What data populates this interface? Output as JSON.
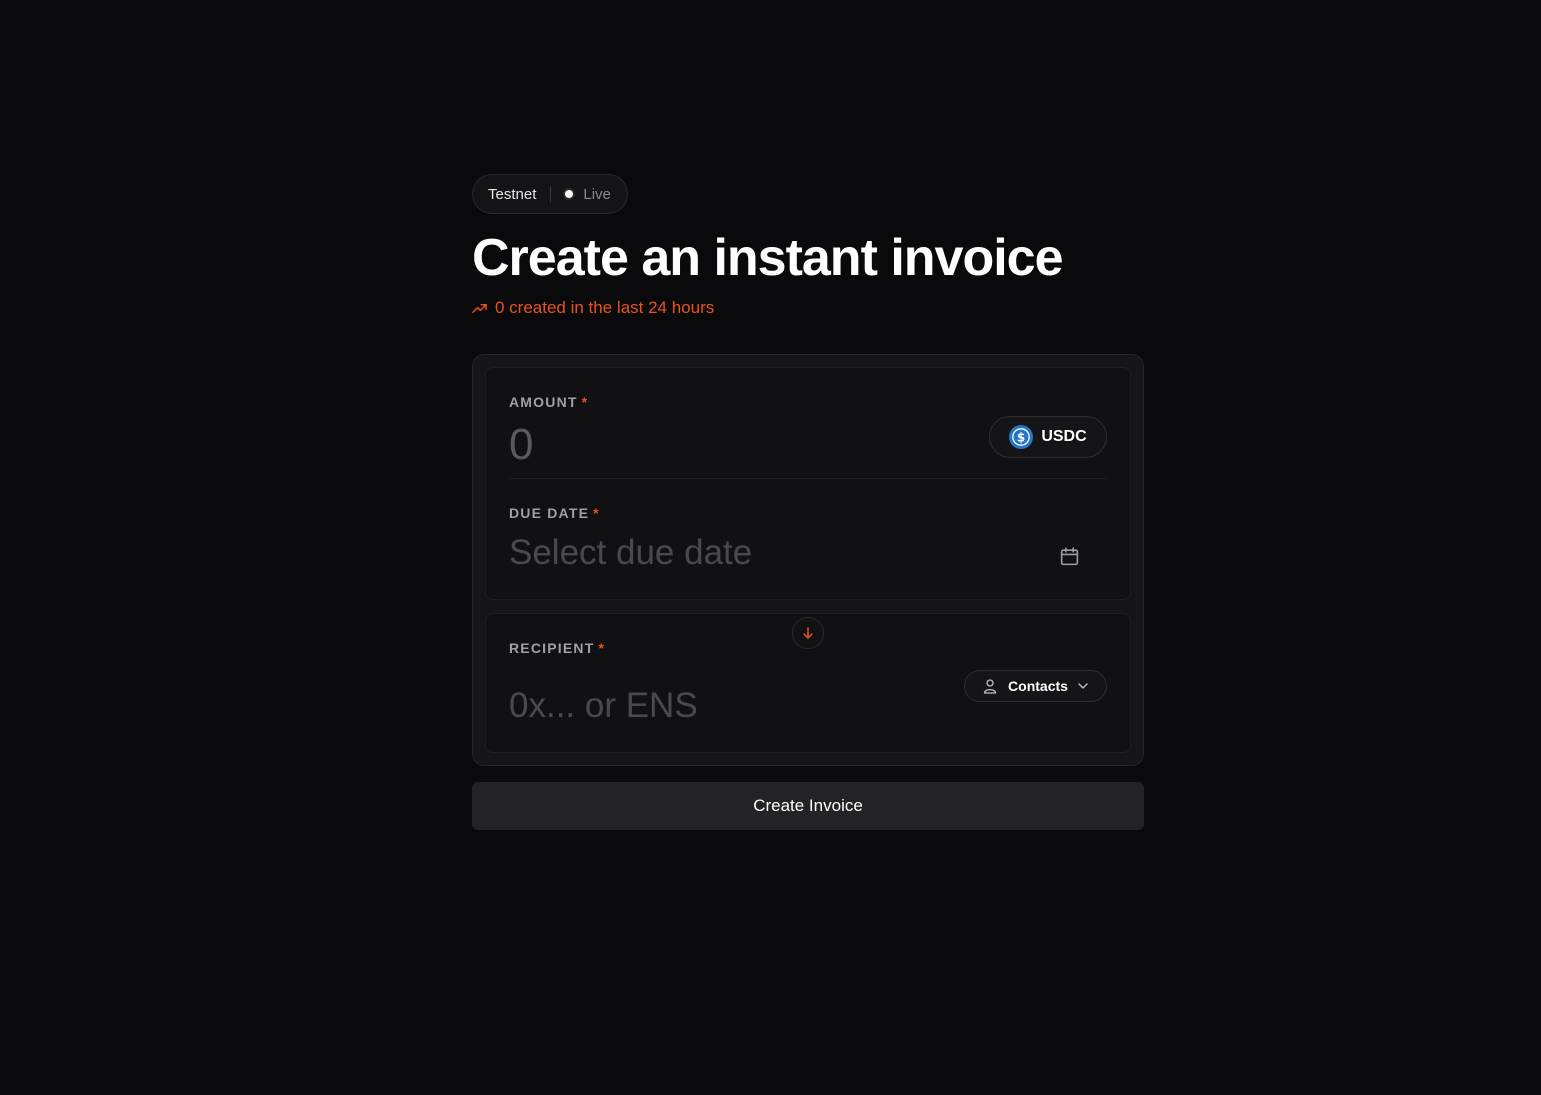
{
  "network": {
    "testnet_label": "Testnet",
    "live_label": "Live"
  },
  "header": {
    "title": "Create an instant invoice",
    "stat_text": "0 created in the last 24 hours"
  },
  "amount": {
    "label": "AMOUNT",
    "required_marker": "*",
    "placeholder": "0",
    "token": "USDC"
  },
  "due_date": {
    "label": "DUE DATE",
    "required_marker": "*",
    "placeholder": "Select due date"
  },
  "recipient": {
    "label": "RECIPIENT",
    "required_marker": "*",
    "placeholder": "0x... or ENS",
    "contacts_label": "Contacts"
  },
  "actions": {
    "create_label": "Create Invoice"
  },
  "colors": {
    "accent": "#e8541e",
    "background": "#0a0a0c",
    "usdc_blue": "#2775ca"
  },
  "icons": [
    "trend-up-icon",
    "usdc-icon",
    "calendar-icon",
    "arrow-down-icon",
    "person-icon",
    "chevron-down-icon"
  ]
}
